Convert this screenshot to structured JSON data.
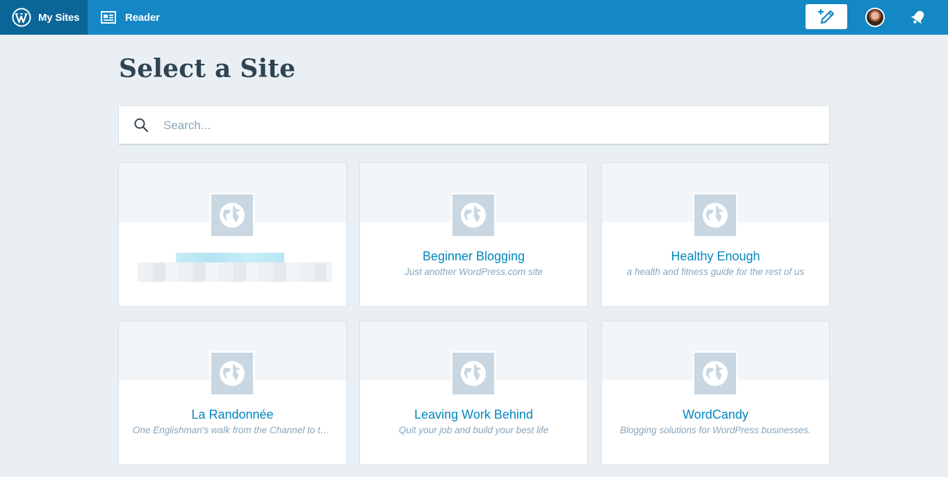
{
  "masterbar": {
    "my_sites_label": "My Sites",
    "reader_label": "Reader",
    "icons": {
      "logo": "wordpress-logo-icon",
      "reader": "reader-icon",
      "write": "write-post-icon",
      "avatar": "user-avatar",
      "notifications": "notifications-bell-icon"
    }
  },
  "page": {
    "title": "Select a Site"
  },
  "search": {
    "placeholder": "Search..."
  },
  "sites": [
    {
      "title": "",
      "tagline": "",
      "blurred": true
    },
    {
      "title": "Beginner Blogging",
      "tagline": "Just another WordPress.com site"
    },
    {
      "title": "Healthy Enough",
      "tagline": "a health and fitness guide for the rest of us"
    },
    {
      "title": "La Randonnée",
      "tagline": "One Englishman's walk from the Channel to the Mediterranean"
    },
    {
      "title": "Leaving Work Behind",
      "tagline": "Quit your job and build your best life"
    },
    {
      "title": "WordCandy",
      "tagline": "Blogging solutions for WordPress businesses."
    }
  ],
  "colors": {
    "masterbar": "#1388c4",
    "masterbar_active": "#0b6697",
    "background": "#e9eff3",
    "link": "#0087be",
    "muted": "#87a6bc",
    "site_icon_bg": "#c8d7e1"
  }
}
